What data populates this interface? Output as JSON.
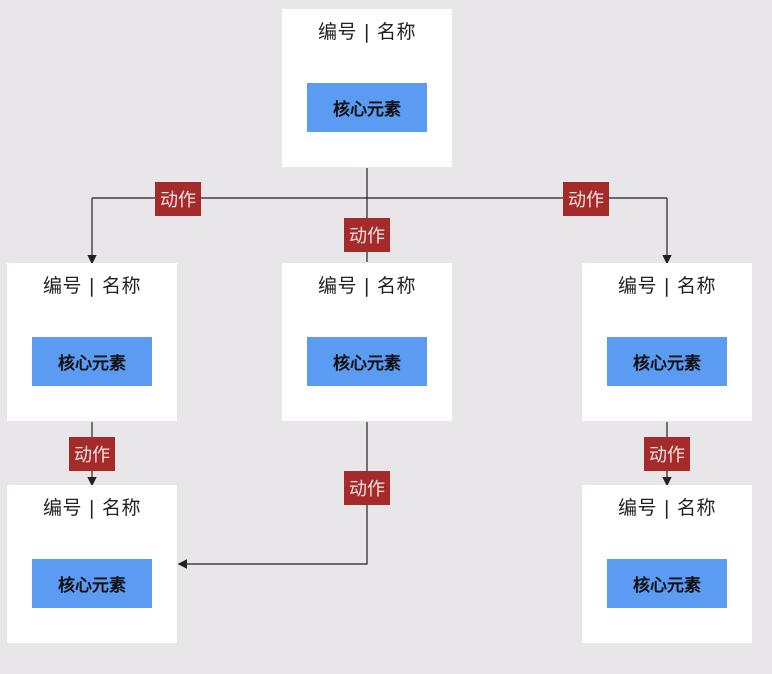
{
  "nodes": [
    {
      "id": "root",
      "title": "编号 | 名称",
      "core": "核心元素"
    },
    {
      "id": "left-mid",
      "title": "编号 | 名称",
      "core": "核心元素"
    },
    {
      "id": "center-mid",
      "title": "编号 | 名称",
      "core": "核心元素"
    },
    {
      "id": "right-mid",
      "title": "编号 | 名称",
      "core": "核心元素"
    },
    {
      "id": "left-bottom",
      "title": "编号 | 名称",
      "core": "核心元素"
    },
    {
      "id": "right-bottom",
      "title": "编号 | 名称",
      "core": "核心元素"
    }
  ],
  "edges": [
    {
      "from": "root",
      "to": "left-mid",
      "label": "动作"
    },
    {
      "from": "root",
      "to": "center-mid",
      "label": "动作"
    },
    {
      "from": "root",
      "to": "right-mid",
      "label": "动作"
    },
    {
      "from": "left-mid",
      "to": "left-bottom",
      "label": "动作"
    },
    {
      "from": "center-mid",
      "to": "left-bottom",
      "label": "动作"
    },
    {
      "from": "right-mid",
      "to": "right-bottom",
      "label": "动作"
    }
  ],
  "colors": {
    "background": "#e9e6e9",
    "node": "#ffffff",
    "core": "#5b9bf2",
    "action": "#a52a2a",
    "line": "#222222"
  }
}
